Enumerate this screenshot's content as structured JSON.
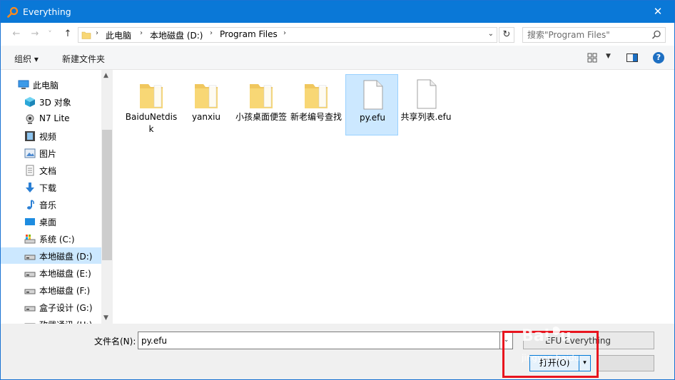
{
  "window": {
    "title": "Everything",
    "close_glyph": "✕"
  },
  "address": {
    "back_glyph": "←",
    "forward_glyph": "→",
    "recent_glyph": "˅",
    "up_glyph": "↑",
    "breadcrumb": [
      "此电脑",
      "本地磁盘 (D:)",
      "Program Files"
    ],
    "separator": "›",
    "dropdown_glyph": "⌄",
    "refresh_glyph": "↻",
    "search_placeholder": "搜索\"Program Files\""
  },
  "toolbar": {
    "organize_label": "组织 ▾",
    "new_folder_label": "新建文件夹",
    "help_glyph": "?"
  },
  "nav": {
    "items": [
      {
        "label": "此电脑",
        "icon": "computer-icon"
      },
      {
        "label": "3D 对象",
        "icon": "cube-3d-icon"
      },
      {
        "label": "N7 Lite",
        "icon": "webcam-icon"
      },
      {
        "label": "视频",
        "icon": "video-icon"
      },
      {
        "label": "图片",
        "icon": "pictures-icon"
      },
      {
        "label": "文档",
        "icon": "documents-icon"
      },
      {
        "label": "下载",
        "icon": "download-icon"
      },
      {
        "label": "音乐",
        "icon": "music-icon"
      },
      {
        "label": "桌面",
        "icon": "desktop-icon"
      },
      {
        "label": "系统 (C:)",
        "icon": "system-drive-icon"
      },
      {
        "label": "本地磁盘 (D:)",
        "icon": "drive-icon",
        "selected": true
      },
      {
        "label": "本地磁盘 (E:)",
        "icon": "drive-icon"
      },
      {
        "label": "本地磁盘 (F:)",
        "icon": "drive-icon"
      },
      {
        "label": "盒子设计 (G:)",
        "icon": "drive-icon"
      },
      {
        "label": "政武通讯 (H:)",
        "icon": "drive-icon"
      }
    ]
  },
  "files": [
    {
      "name": "BaiduNetdisk",
      "type": "folder"
    },
    {
      "name": "yanxiu",
      "type": "folder"
    },
    {
      "name": "小孩桌面便签",
      "type": "folder"
    },
    {
      "name": "新老编号查找",
      "type": "folder"
    },
    {
      "name": "py.efu",
      "type": "file",
      "selected": true
    },
    {
      "name": "共享列表.efu",
      "type": "file"
    }
  ],
  "bottom": {
    "filename_label": "文件名(N):",
    "filename_value": "py.efu",
    "filter_value": "EFU Everything",
    "open_label": "打开(O)",
    "open_dropdown_glyph": "▾",
    "dropdown_glyph": "⌄",
    "watermark_text": "Baidu jingyan.baidu"
  },
  "colors": {
    "titlebar": "#0a78d7",
    "selection": "#cce8ff",
    "highlight": "#e8141e",
    "folder": "#f8d775"
  }
}
